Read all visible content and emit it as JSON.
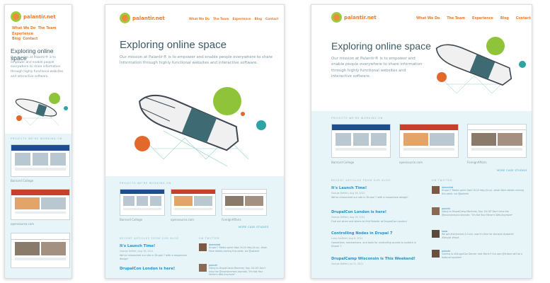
{
  "site": {
    "logo": "palantir.net",
    "nav": [
      "What We Do",
      "The Team",
      "Experience",
      "Blog",
      "Contact"
    ],
    "headline": "Exploring online space",
    "mission": "Our mission at Palantir® is to empower and enable people everywhere to share information through highly functional websites and interactive software."
  },
  "projects": {
    "label": "PROJECTS WE'RE WORKING ON",
    "items": [
      "Barnard College",
      "opensource.com",
      "ForeignAffairs"
    ],
    "more": "MORE CASE STUDIES"
  },
  "blog": {
    "label": "RECENT ARTICLES FROM OUR BLOG",
    "posts": [
      {
        "title": "It's Launch Time!",
        "meta": "George DeMet | Aug 26, 2011",
        "body": "We've relaunched our site in Drupal 7 with a responsive design!"
      },
      {
        "title": "DrupalCon London is here!",
        "meta": "George DeMet | Aug 19, 2011",
        "body": "Find out when and where to find Palantir at DrupalCon London!"
      },
      {
        "title": "Controlling Nodes in Drupal 7",
        "meta": "Larry Garfield | Aug 8, 2011",
        "body": "Operations, mechanisms, and tools for controlling access to content in Drupal 7."
      },
      {
        "title": "DrupalCamp Wisconsin is This Weekend!",
        "meta": "George DeMet | Jul 21, 2011",
        "body": ""
      }
    ]
  },
  "twitter": {
    "label": "ON TWITTER",
    "tweets": [
      {
        "user": "damented",
        "text": "Drupal 7 Media sprint Sept 16-20 http://t.co/...#aoh More details coming this week. via @palantir"
      },
      {
        "user": "palantir",
        "text": "Going to DrupalCamp Montreal, Sep. 16-18? Don't miss the @anonsimmons keynote, \"It's Not Your Father's Web Anymore\""
      },
      {
        "user": "kwoo",
        "text": "We got #ionfunnels 2.0 out, now it's time for #acquia #palantir #Drupal #hack"
      },
      {
        "user": "palantir",
        "text": "Coming to #DrupalCon Denver next March? Our own @kristen will be a featured speaker!"
      }
    ]
  },
  "colors": {
    "accent": "#f07a28",
    "heading": "#3c5a66",
    "link": "#2a8fc4",
    "section_bg": "#e7f5f9"
  }
}
